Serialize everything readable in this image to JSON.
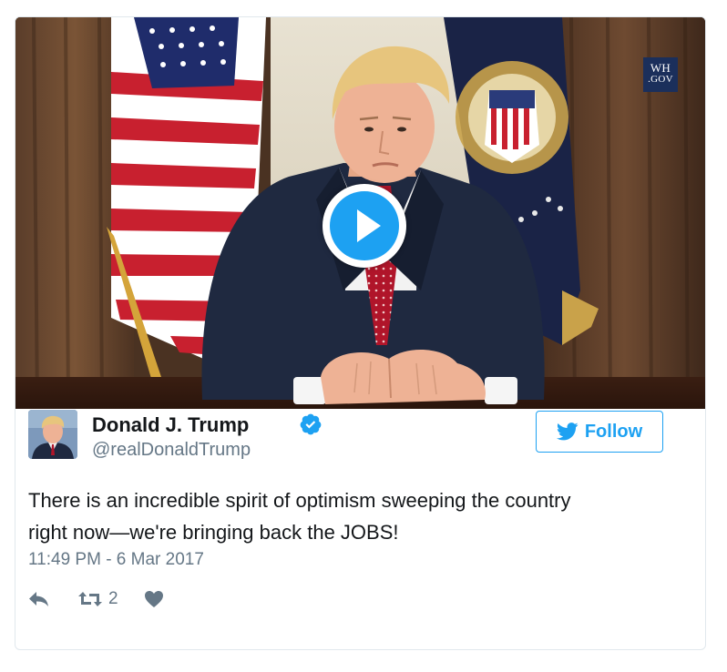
{
  "media": {
    "badge_line1": "WH",
    "badge_line2": ".GOV",
    "play_icon": "play-icon"
  },
  "author": {
    "display_name": "Donald J. Trump",
    "handle": "@realDonaldTrump",
    "verified_icon": "verified-badge-icon",
    "avatar_icon": "avatar"
  },
  "follow": {
    "label": "Follow",
    "icon": "twitter-bird-icon"
  },
  "tweet": {
    "text_line1": "There is an incredible spirit of optimism sweeping the country",
    "text_line2": "right now—we're bringing back the JOBS!",
    "timestamp": "11:49 PM - 6 Mar 2017"
  },
  "actions": {
    "reply_icon": "reply-icon",
    "retweet_icon": "retweet-icon",
    "retweet_count": "2",
    "like_icon": "heart-icon"
  },
  "colors": {
    "accent": "#1da1f2",
    "secondary_text": "#657786",
    "primary_text": "#14171a",
    "border": "#e1e8ed"
  }
}
